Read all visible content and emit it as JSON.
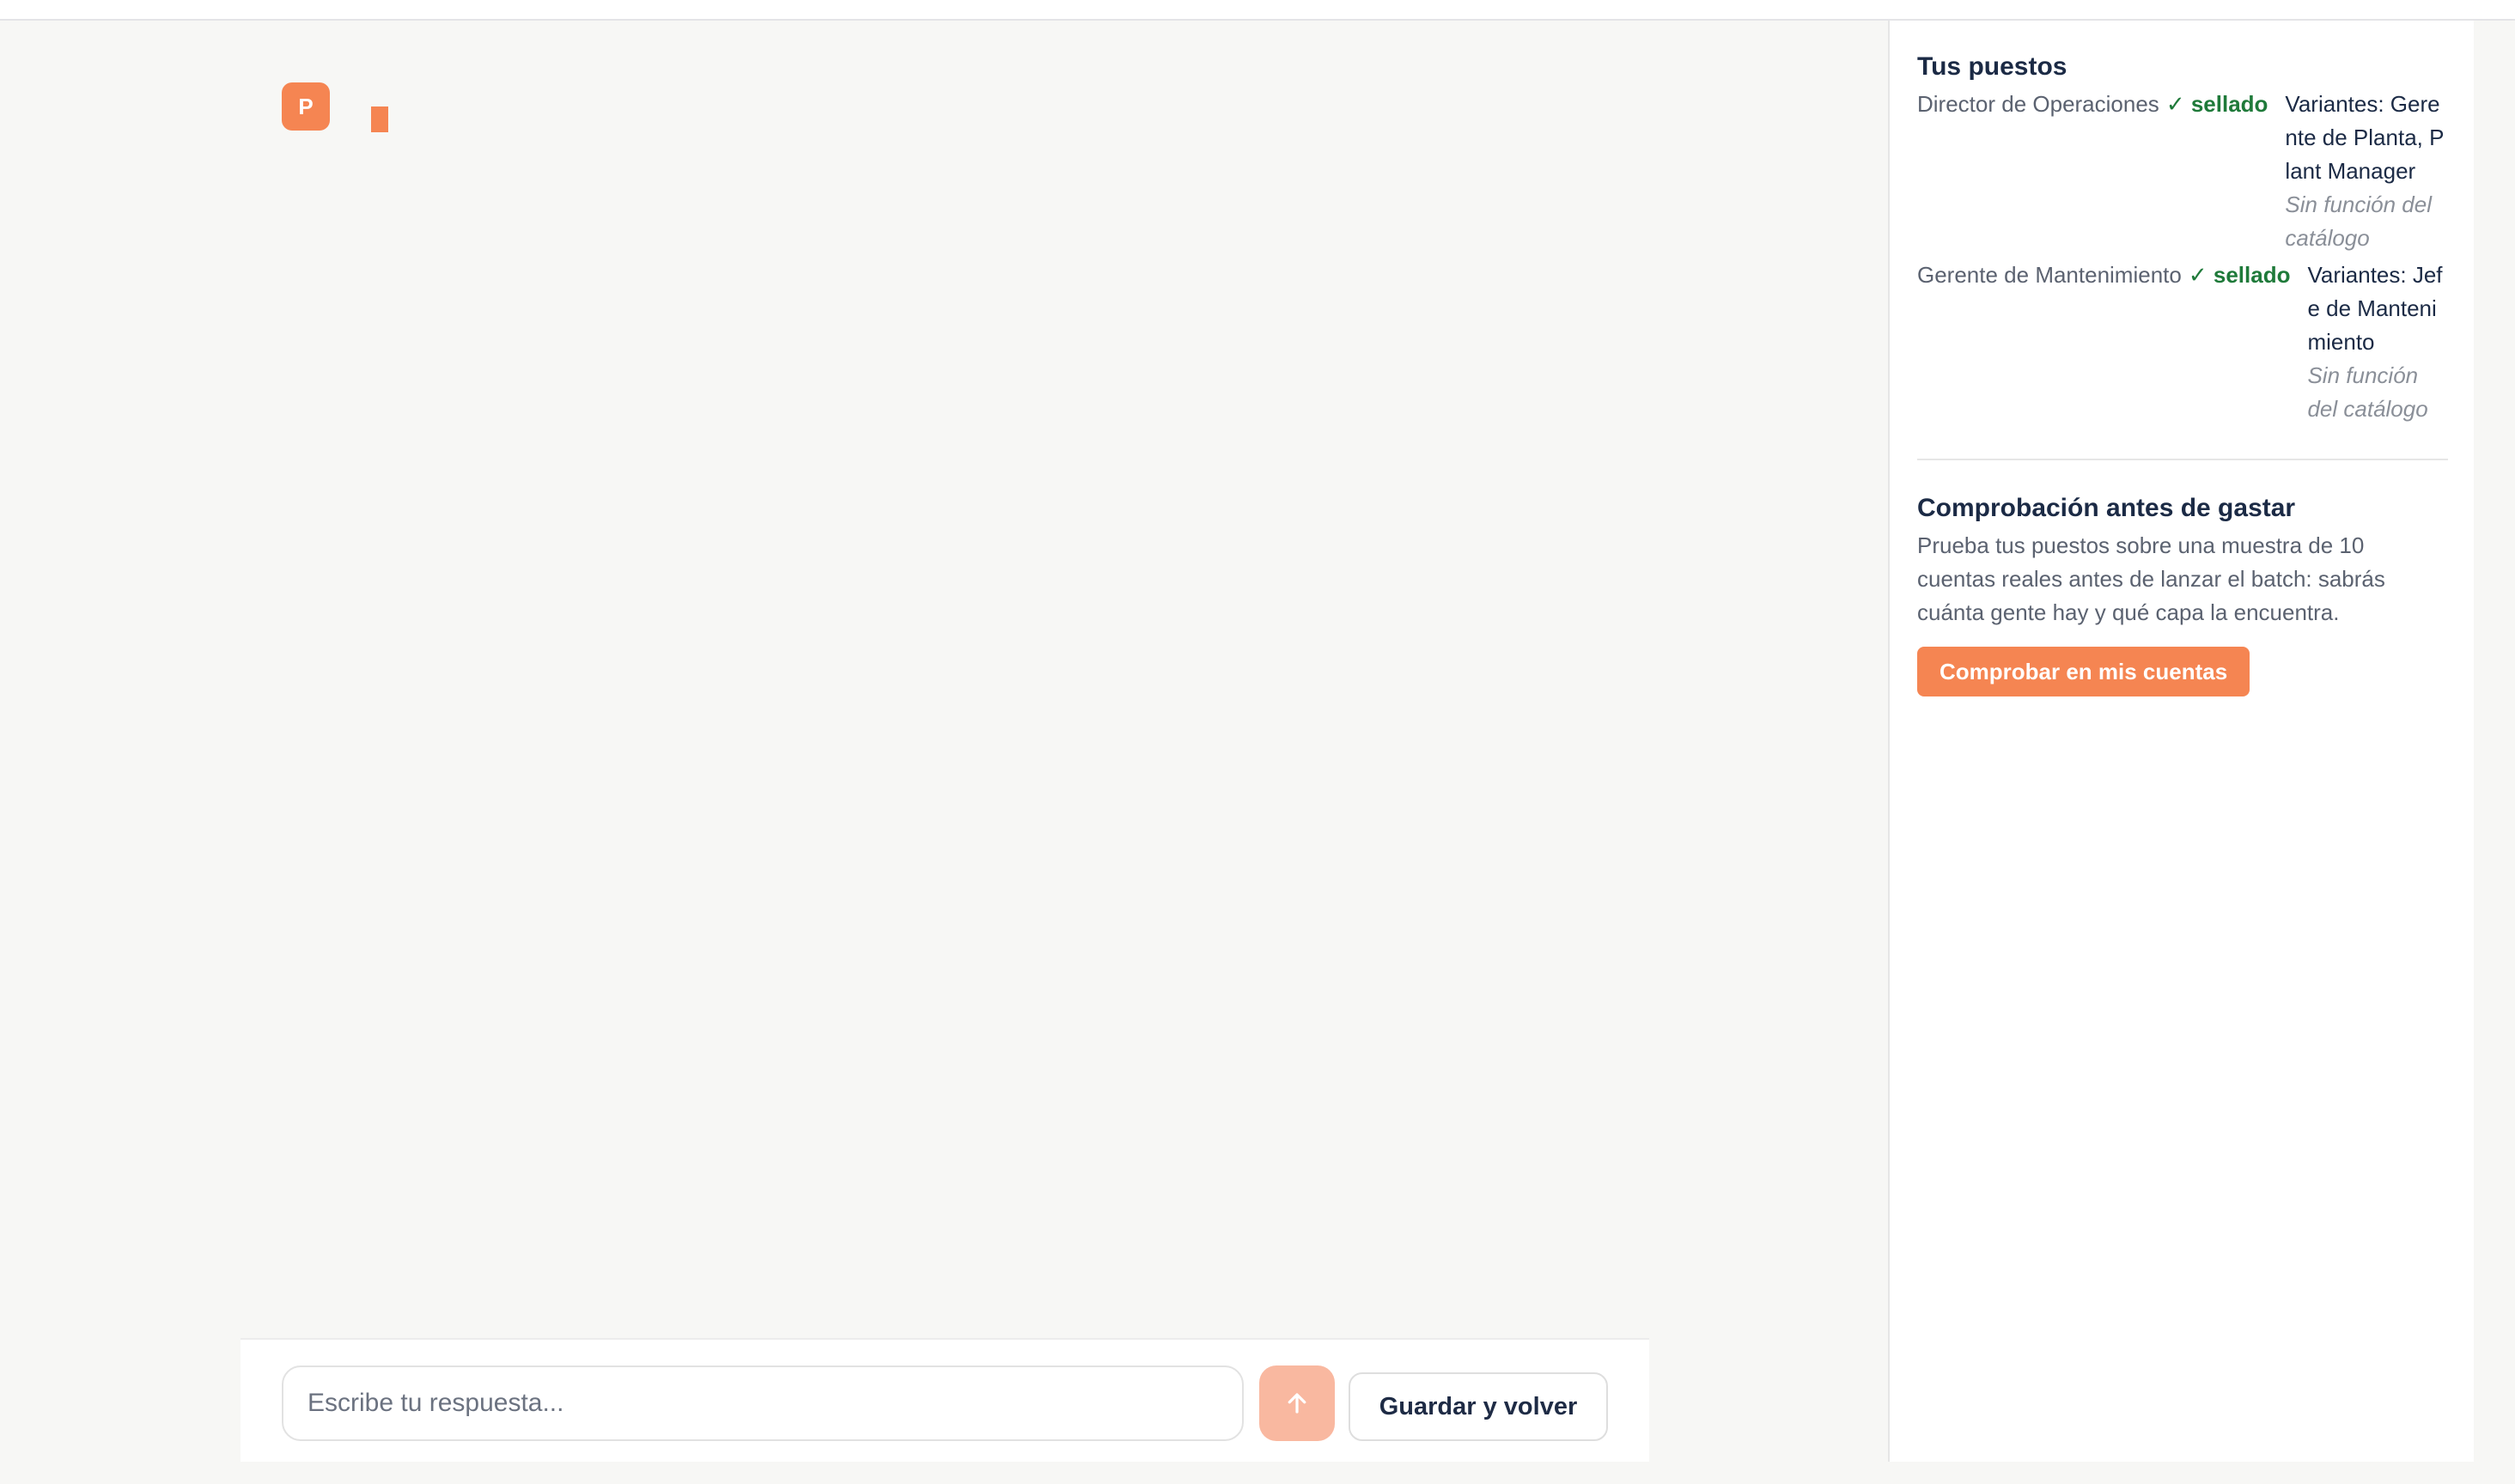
{
  "chat": {
    "avatar_letter": "P",
    "input_placeholder": "Escribe tu respuesta...",
    "save_label": "Guardar y volver"
  },
  "sidebar": {
    "positions_title": "Tus puestos",
    "positions": [
      {
        "name": "Director de Operaciones",
        "status": "✓ sellado",
        "variants": "Variantes: Gerente de Planta, Plant Manager",
        "note": "Sin función del catálogo"
      },
      {
        "name": "Gerente de Mantenimiento",
        "status": "✓ sellado",
        "variants": "Variantes: Jefe de Mantenimiento",
        "note": "Sin función del catálogo"
      }
    ],
    "check_title": "Comprobación antes de gastar",
    "check_description": "Prueba tus puestos sobre una muestra de 10 cuentas reales antes de lanzar el batch: sabrás cuánta gente hay y qué capa la encuentra.",
    "check_button": "Comprobar en mis cuentas"
  },
  "colors": {
    "accent": "#f58552",
    "accent_light": "#f9b8a0",
    "sealed_green": "#1f7a3a",
    "heading": "#1b2a45"
  },
  "icons": {
    "send": "arrow-up-icon"
  }
}
